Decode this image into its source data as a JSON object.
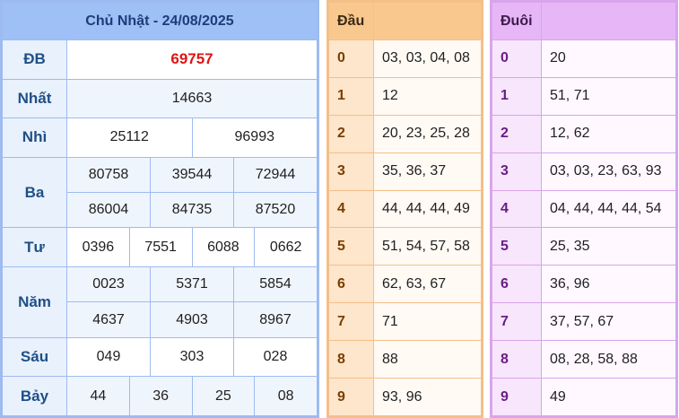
{
  "results": {
    "title": "Chủ Nhật - 24/08/2025",
    "rows": {
      "db": {
        "label": "ĐB",
        "values": [
          "69757"
        ]
      },
      "nhat": {
        "label": "Nhất",
        "values": [
          "14663"
        ]
      },
      "nhi": {
        "label": "Nhì",
        "values": [
          "25112",
          "96993"
        ]
      },
      "ba": {
        "label": "Ba",
        "values": [
          "80758",
          "39544",
          "72944",
          "86004",
          "84735",
          "87520"
        ]
      },
      "tu": {
        "label": "Tư",
        "values": [
          "0396",
          "7551",
          "6088",
          "0662"
        ]
      },
      "nam": {
        "label": "Năm",
        "values": [
          "0023",
          "5371",
          "5854",
          "4637",
          "4903",
          "8967"
        ]
      },
      "sau": {
        "label": "Sáu",
        "values": [
          "049",
          "303",
          "028"
        ]
      },
      "bay": {
        "label": "Bảy",
        "values": [
          "44",
          "36",
          "25",
          "08"
        ]
      }
    }
  },
  "dau": {
    "header": "Đầu",
    "rows": [
      {
        "num": "0",
        "vals": "03, 03, 04, 08"
      },
      {
        "num": "1",
        "vals": "12"
      },
      {
        "num": "2",
        "vals": "20, 23, 25, 28"
      },
      {
        "num": "3",
        "vals": "35, 36, 37"
      },
      {
        "num": "4",
        "vals": "44, 44, 44, 49"
      },
      {
        "num": "5",
        "vals": "51, 54, 57, 58"
      },
      {
        "num": "6",
        "vals": "62, 63, 67"
      },
      {
        "num": "7",
        "vals": "71"
      },
      {
        "num": "8",
        "vals": "88"
      },
      {
        "num": "9",
        "vals": "93, 96"
      }
    ]
  },
  "duoi": {
    "header": "Đuôi",
    "rows": [
      {
        "num": "0",
        "vals": "20"
      },
      {
        "num": "1",
        "vals": "51, 71"
      },
      {
        "num": "2",
        "vals": "12, 62"
      },
      {
        "num": "3",
        "vals": "03, 03, 23, 63, 93"
      },
      {
        "num": "4",
        "vals": "04, 44, 44, 44, 54"
      },
      {
        "num": "5",
        "vals": "25, 35"
      },
      {
        "num": "6",
        "vals": "36, 96"
      },
      {
        "num": "7",
        "vals": "37, 57, 67"
      },
      {
        "num": "8",
        "vals": "08, 28, 58, 88"
      },
      {
        "num": "9",
        "vals": "49"
      }
    ]
  },
  "colors": {
    "special_prize": "#e01414",
    "results_accent": "#9ec0f7",
    "dau_accent": "#f9c88f",
    "duoi_accent": "#e7b6f6"
  }
}
